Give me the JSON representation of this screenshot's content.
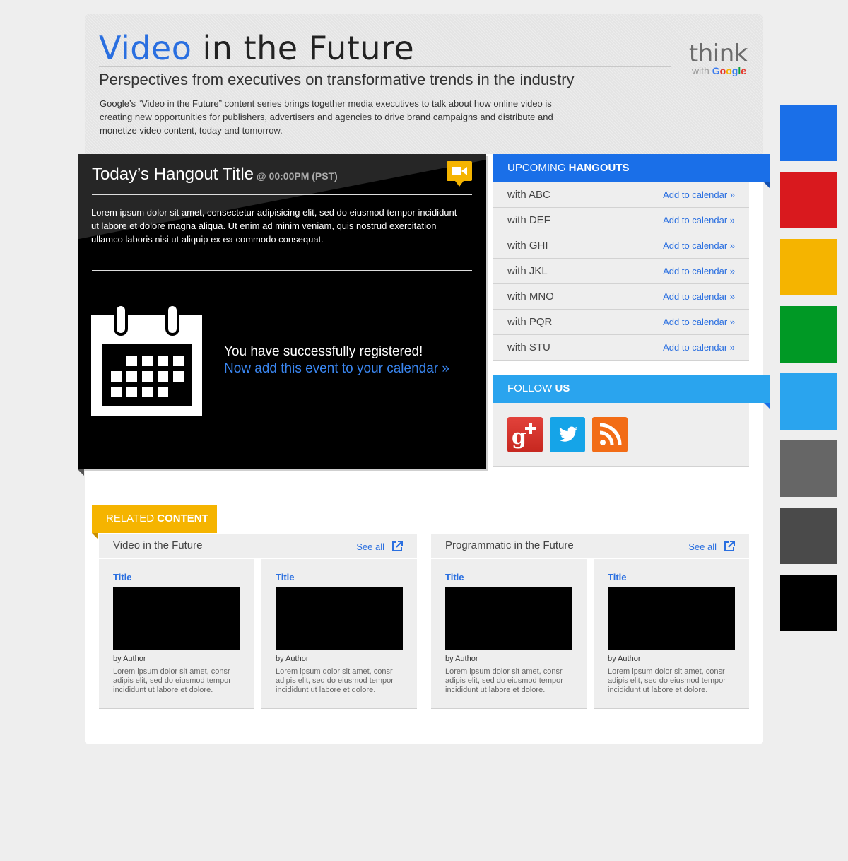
{
  "header": {
    "title_accent": "Video",
    "title_rest": " in the Future",
    "subtitle": "Perspectives from executives on transformative trends in the industry",
    "intro": "Google’s “Video in the Future” content series brings together media executives to talk about how online video is creating new opportunities for publishers, advertisers and agencies to drive brand campaigns and distribute and monetize video content, today and tomorrow.",
    "logo_think": "think",
    "logo_with": "with",
    "logo_google": "Google"
  },
  "hangout": {
    "title": "Today’s Hangout Title",
    "time": "@ 00:00PM (PST)",
    "description": "Lorem ipsum dolor sit amet, consectetur adipisicing elit, sed do eiusmod tempor incididunt ut labore et dolore magna aliqua. Ut enim ad minim veniam, quis nostrud exercitation ullamco laboris nisi ut aliquip ex ea commodo consequat.",
    "registered_msg": "You have successfully registered!",
    "calendar_link": "Now add this event to your calendar »"
  },
  "upcoming": {
    "label_light": "UPCOMING ",
    "label_bold": "HANGOUTS",
    "items": [
      {
        "name": "with ABC",
        "action": "Add to calendar »"
      },
      {
        "name": "with DEF",
        "action": "Add to calendar »"
      },
      {
        "name": "with GHI",
        "action": "Add to calendar »"
      },
      {
        "name": "with JKL",
        "action": "Add to calendar »"
      },
      {
        "name": "with MNO",
        "action": "Add to calendar »"
      },
      {
        "name": "with PQR",
        "action": "Add to calendar »"
      },
      {
        "name": "with STU",
        "action": "Add to calendar »"
      }
    ]
  },
  "follow": {
    "label_light": "FOLLOW ",
    "label_bold": "US",
    "icons": [
      "google-plus-icon",
      "twitter-icon",
      "rss-icon"
    ]
  },
  "related": {
    "label_light": "RELATED ",
    "label_bold": "CONTENT",
    "groups": [
      {
        "title": "Video in the Future",
        "see_all": "See all",
        "cards": [
          {
            "title": "Title",
            "author": "by Author",
            "excerpt": "Lorem ipsum dolor sit amet, consr adipis elit, sed do eiusmod tempor incididunt ut labore et dolore."
          },
          {
            "title": "Title",
            "author": "by Author",
            "excerpt": "Lorem ipsum dolor sit amet, consr adipis elit, sed do eiusmod tempor incididunt ut labore et dolore."
          }
        ]
      },
      {
        "title": "Programmatic in the Future",
        "see_all": "See all",
        "cards": [
          {
            "title": "Title",
            "author": "by Author",
            "excerpt": "Lorem ipsum dolor sit amet, consr adipis elit, sed do eiusmod tempor incididunt ut labore et dolore."
          },
          {
            "title": "Title",
            "author": "by Author",
            "excerpt": "Lorem ipsum dolor sit amet, consr adipis elit, sed do eiusmod tempor incididunt ut labore et dolore."
          }
        ]
      }
    ]
  },
  "colors": {
    "accent_blue": "#2a6fe0",
    "hangouts_blue": "#1a6fe8",
    "follow_blue": "#2aa4ee",
    "related_yellow": "#f5b400",
    "swatches": [
      "#1a6fe8",
      "#d9191e",
      "#f5b400",
      "#009925",
      "#2aa4ee",
      "#666666",
      "#4a4a4a",
      "#000000"
    ]
  }
}
